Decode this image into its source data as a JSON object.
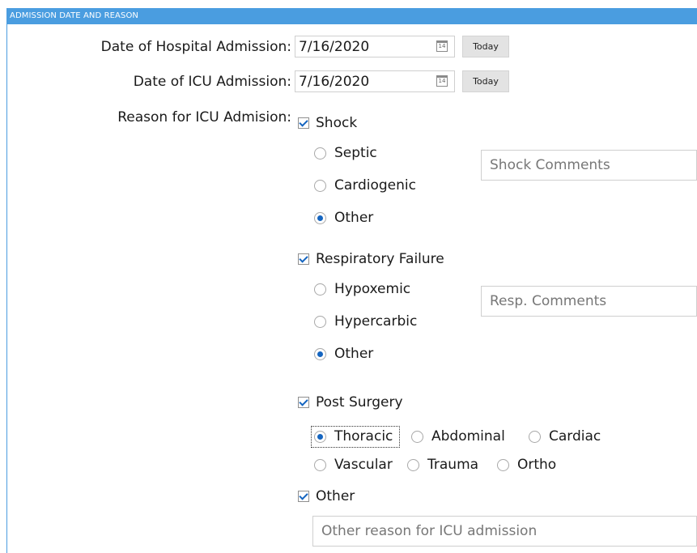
{
  "section": {
    "title": "ADMISSION DATE AND REASON"
  },
  "hospital_admission": {
    "label": "Date of Hospital Admission:",
    "value": "7/16/2020",
    "today_label": "Today",
    "icon": "calendar-icon"
  },
  "icu_admission": {
    "label": "Date of ICU Admission:",
    "value": "7/16/2020",
    "today_label": "Today",
    "icon": "calendar-icon"
  },
  "reason": {
    "label": "Reason for ICU Admision:",
    "shock": {
      "label": "Shock",
      "checked": true,
      "options": [
        {
          "label": "Septic",
          "selected": false
        },
        {
          "label": "Cardiogenic",
          "selected": false
        },
        {
          "label": "Other",
          "selected": true
        }
      ],
      "comments_placeholder": "Shock Comments"
    },
    "respiratory": {
      "label": "Respiratory Failure",
      "checked": true,
      "options": [
        {
          "label": "Hypoxemic",
          "selected": false
        },
        {
          "label": "Hypercarbic",
          "selected": false
        },
        {
          "label": "Other",
          "selected": true
        }
      ],
      "comments_placeholder": "Resp. Comments"
    },
    "post_surgery": {
      "label": "Post Surgery",
      "checked": true,
      "options": [
        {
          "label": "Thoracic",
          "selected": true
        },
        {
          "label": "Abdominal",
          "selected": false
        },
        {
          "label": "Cardiac",
          "selected": false
        },
        {
          "label": "Vascular",
          "selected": false
        },
        {
          "label": "Trauma",
          "selected": false
        },
        {
          "label": "Ortho",
          "selected": false
        }
      ]
    },
    "other": {
      "label": "Other",
      "checked": true,
      "placeholder": "Other reason for ICU admission"
    }
  },
  "colors": {
    "header": "#4a9de0",
    "accent": "#1565c0"
  }
}
